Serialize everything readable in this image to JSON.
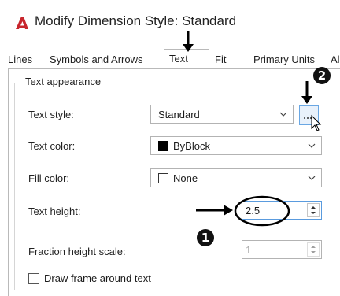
{
  "window": {
    "title": "Modify Dimension Style: Standard",
    "logo_color": "#c8262d"
  },
  "tabs": [
    {
      "label": "Lines"
    },
    {
      "label": "Symbols and Arrows"
    },
    {
      "label": "Text",
      "active": true
    },
    {
      "label": "Fit"
    },
    {
      "label": "Primary Units"
    },
    {
      "label": "Al"
    }
  ],
  "text_appearance": {
    "group_label": "Text appearance",
    "text_style": {
      "label": "Text style:",
      "value": "Standard"
    },
    "text_color": {
      "label": "Text color:",
      "value": "ByBlock",
      "swatch_color": "#000000"
    },
    "fill_color": {
      "label": "Fill color:",
      "value": "None",
      "swatch_color": "#ffffff"
    },
    "text_height": {
      "label": "Text height:",
      "value": "2.5"
    },
    "fraction_height_scale": {
      "label": "Fraction height scale:",
      "value": "1"
    },
    "draw_frame": {
      "label": "Draw frame around text",
      "checked": false
    }
  },
  "annotations": {
    "badge_1": "1",
    "badge_2": "2"
  },
  "icons": [
    "autocad-logo-icon",
    "chevron-down-icon",
    "ellipsis-icon",
    "cursor-icon",
    "spin-up-icon",
    "spin-down-icon",
    "arrow-annotation-icon"
  ]
}
